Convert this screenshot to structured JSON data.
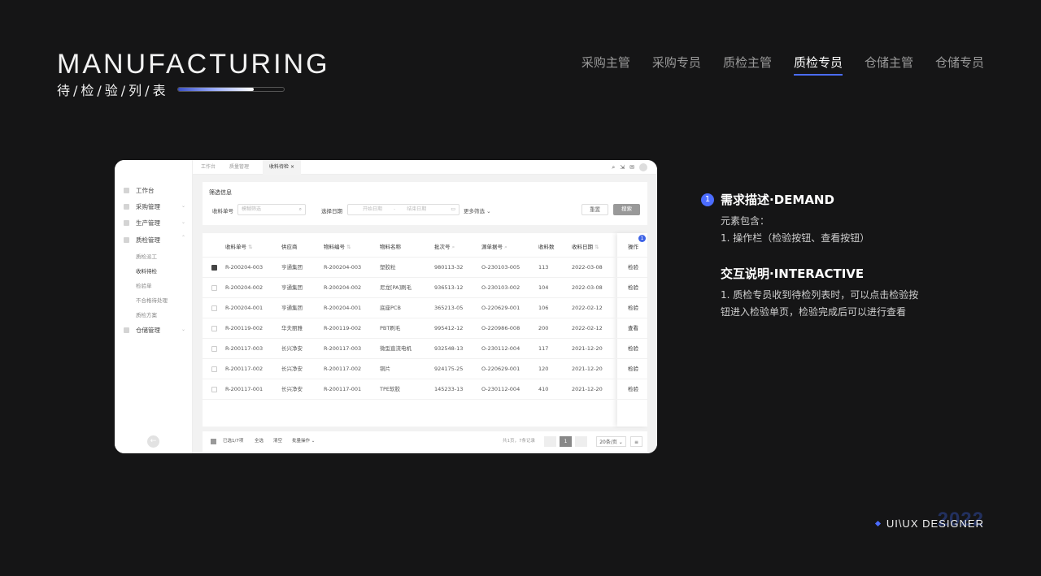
{
  "header": {
    "title": "MANUFACTURING",
    "subtitle": "待/检/验/列/表",
    "progress": 0.72
  },
  "roles": [
    {
      "label": "采购主管",
      "active": false
    },
    {
      "label": "采购专员",
      "active": false
    },
    {
      "label": "质检主管",
      "active": false
    },
    {
      "label": "质检专员",
      "active": true
    },
    {
      "label": "仓储主管",
      "active": false
    },
    {
      "label": "仓储专员",
      "active": false
    }
  ],
  "mock": {
    "tabs": [
      "工作台",
      "质量管理",
      "收料待检"
    ],
    "tab_close": "×",
    "sidebar": {
      "items": [
        "工作台",
        "采购管理",
        "生产管理",
        "质检管理",
        "仓储管理"
      ],
      "subitems": [
        "质检派工",
        "收料待检",
        "检验单",
        "不合格待处理",
        "质检方案"
      ],
      "back_icon": "←"
    },
    "filter": {
      "title": "筛选信息",
      "receipt_label": "收料单号",
      "receipt_placeholder": "模糊筛选",
      "date_label": "选择日期",
      "start_placeholder": "开始日期",
      "end_placeholder": "结束日期",
      "more": "更多筛选",
      "reset": "重置",
      "search": "搜索"
    },
    "table": {
      "headers": [
        "收料单号",
        "供应商",
        "物料编号",
        "物料名称",
        "批次号",
        "源单据号",
        "收料数",
        "收料日期",
        "操作"
      ],
      "rows": [
        {
          "checked": true,
          "cells": [
            "R-200204-003",
            "亨通集团",
            "R-200204-003",
            "塑胶粒",
            "980113-32",
            "O-230103-005",
            "113",
            "2022-03-08",
            "检验"
          ]
        },
        {
          "checked": false,
          "cells": [
            "R-200204-002",
            "亨通集团",
            "R-200204-002",
            "尼龙[PA]刷毛",
            "936513-12",
            "O-230103-002",
            "104",
            "2022-03-08",
            "检验"
          ]
        },
        {
          "checked": false,
          "cells": [
            "R-200204-001",
            "亨通集团",
            "R-200204-001",
            "底座PCB",
            "365213-05",
            "O-220629-001",
            "106",
            "2022-02-12",
            "检验"
          ]
        },
        {
          "checked": false,
          "cells": [
            "R-200119-002",
            "华夫丽雅",
            "R-200119-002",
            "PBT刷毛",
            "995412-12",
            "O-220986-008",
            "200",
            "2022-02-12",
            "查看"
          ]
        },
        {
          "checked": false,
          "cells": [
            "R-200117-003",
            "长兴净安",
            "R-200117-003",
            "微型直流电机",
            "932548-13",
            "O-230112-004",
            "117",
            "2021-12-20",
            "检验"
          ]
        },
        {
          "checked": false,
          "cells": [
            "R-200117-002",
            "长兴净安",
            "R-200117-002",
            "铜片",
            "924175-25",
            "O-220629-001",
            "120",
            "2021-12-20",
            "检验"
          ]
        },
        {
          "checked": false,
          "cells": [
            "R-200117-001",
            "长兴净安",
            "R-200117-001",
            "TPE软胶",
            "145233-13",
            "O-230112-004",
            "410",
            "2021-12-20",
            "检验"
          ]
        }
      ],
      "badge": "1"
    },
    "footer": {
      "selected": "已选1/7项",
      "select_all": "全选",
      "clear": "清空",
      "batch": "批量操作",
      "summary": "共1页，7条记录",
      "page": "1",
      "page_size": "20条/页"
    }
  },
  "description": {
    "num": "1",
    "demand_title": "需求描述·DEMAND",
    "demand_lines": [
      "元素包含：",
      "1. 操作栏（检验按钮、查看按钮）"
    ],
    "interactive_title": "交互说明·INTERACTIVE",
    "interactive_lines": [
      "1. 质检专员收到待检列表时，可以点击检验按",
      "钮进入检验单页，检验完成后可以进行查看"
    ]
  },
  "footer": {
    "ghost": "2022",
    "text": "UI\\UX DESIGNER"
  }
}
